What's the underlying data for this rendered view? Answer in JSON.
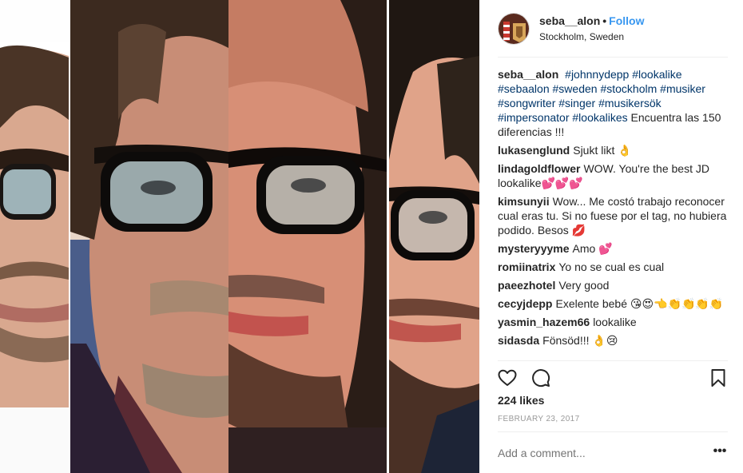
{
  "post": {
    "username": "seba__alon",
    "follow_label": "Follow",
    "location": "Stockholm, Sweden",
    "caption": {
      "username": "seba__alon",
      "tags": [
        "#johnnydepp",
        "#lookalike",
        "#sebaalon",
        "#sweden",
        "#stockholm",
        "#musiker",
        "#songwriter",
        "#singer",
        "#musikersök",
        "#impersonator",
        "#lookalikes"
      ],
      "text": "Encuentra las 150 diferencias !!!"
    },
    "comments": [
      {
        "user": "lukasenglund",
        "text": "Sjukt likt 👌"
      },
      {
        "user": "lindagoldflower",
        "text": "WOW. You're the best JD lookalike💕💕💕"
      },
      {
        "user": "kimsunyii",
        "text": "Wow... Me costó trabajo reconocer cual eras tu. Si no fuese por el tag, no hubiera podido. Besos 💋"
      },
      {
        "user": "mysteryyyme",
        "text": "Amo 💕"
      },
      {
        "user": "romiinatrix",
        "text": "Yo no se cual es cual"
      },
      {
        "user": "paeezhotel",
        "text": "Very good"
      },
      {
        "user": "cecyjdepp",
        "text": "Exelente bebé 😘😍👈👏👏👏👏"
      },
      {
        "user": "yasmin_hazem66",
        "text": "lookalike"
      },
      {
        "user": "sidasda",
        "text": "Fönsöd!!! 👌😢"
      }
    ],
    "likes": "224 likes",
    "date": "FEBRUARY 23, 2017",
    "add_comment_placeholder": "Add a comment...",
    "more_label": "•••"
  },
  "icons": {
    "like": "heart-icon",
    "comment": "comment-icon",
    "save": "bookmark-icon",
    "more": "more-options-icon"
  },
  "colors": {
    "follow": "#3897f0",
    "hashtag": "#003569",
    "muted": "#999999",
    "text": "#262626"
  }
}
